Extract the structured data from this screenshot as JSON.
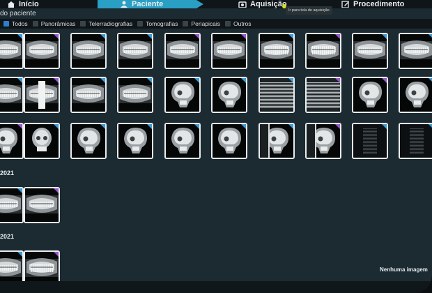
{
  "nav": {
    "steps": [
      {
        "label": "Início",
        "icon": "home-icon"
      },
      {
        "label": "Paciente",
        "icon": "user-icon"
      },
      {
        "label": "Aquisição",
        "icon": "camera-icon"
      },
      {
        "label": "Procedimento",
        "icon": "edit-icon"
      }
    ],
    "active_index": 1,
    "tooltip": "Ir para tela de aquisição"
  },
  "page_title": "do paciente",
  "filters": [
    {
      "label": "Todos",
      "checked": true
    },
    {
      "label": "Panorâmicas",
      "checked": false
    },
    {
      "label": "Telerradiografias",
      "checked": false
    },
    {
      "label": "Tomografias",
      "checked": false
    },
    {
      "label": "Periapicais",
      "checked": false
    },
    {
      "label": "Outros",
      "checked": false
    }
  ],
  "sections": [
    {
      "label": "",
      "rows": [
        [
          "pano-blue",
          "pano-purple",
          "pano-blue",
          "pano-blue",
          "pano-purple",
          "pano-purple",
          "pano-teeth-blue",
          "pano-teeth-purple",
          "pano-blue",
          "pano-blue"
        ],
        [
          "pano-blue",
          "pano-bar-purple",
          "pano-blue",
          "pano-blue",
          "skull-blue",
          "skull-blue",
          "stripes-blue",
          "stripes-purple",
          "skull-purple",
          "skull-blue"
        ],
        [
          "skull-purple",
          "skull-front-blue",
          "skull-blue",
          "skull-blue",
          "skull-blue",
          "skull-blue",
          "skull-split-blue",
          "skull-split-purple",
          "stripes-dark-blue",
          "stripes-dark-blue"
        ]
      ]
    },
    {
      "label": "2021",
      "rows": [
        [
          "pano-blue",
          "pano-purple"
        ]
      ]
    },
    {
      "label": "2021",
      "rows": [
        [
          "pano-blue",
          "pano-teeth-purple"
        ]
      ]
    }
  ],
  "empty_message": "Nenhuma imagem",
  "colors": {
    "accent": "#2a9fc4",
    "tag_blue": "#3b9bd8",
    "tag_purple": "#9d55cf"
  }
}
